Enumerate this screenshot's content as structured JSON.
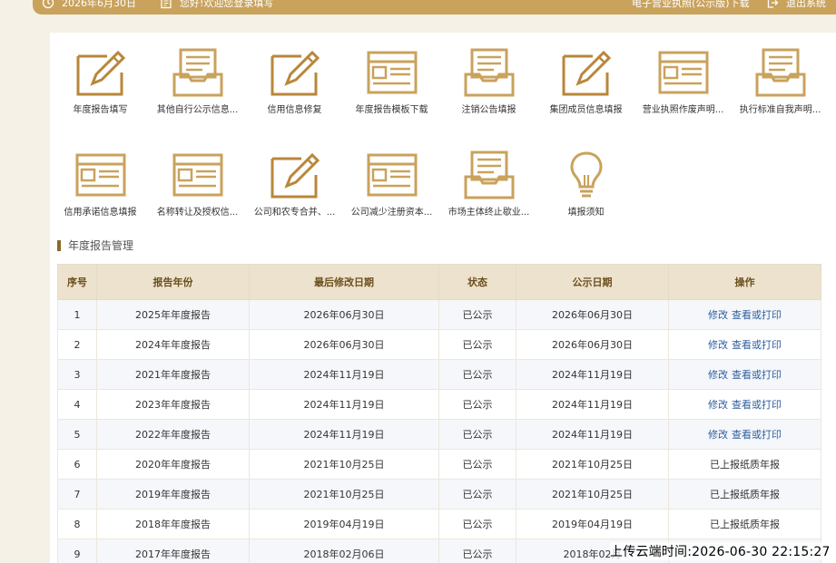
{
  "topbar": {
    "date": "2026年6月30日",
    "message": "您好!欢迎您登录填写",
    "license_download": "电子营业执照(公示版)下载",
    "logout": "退出系统"
  },
  "colors": {
    "accent": "#c9a25c",
    "header_bg": "#ede2cd",
    "link": "#2f5e9e"
  },
  "tiles": [
    {
      "label": "年度报告填写",
      "icon": "pencil-icon"
    },
    {
      "label": "其他自行公示信息...",
      "icon": "inbox-icon"
    },
    {
      "label": "信用信息修复",
      "icon": "pencil-icon"
    },
    {
      "label": "年度报告模板下载",
      "icon": "form-icon"
    },
    {
      "label": "注销公告填报",
      "icon": "inbox-icon"
    },
    {
      "label": "集团成员信息填报",
      "icon": "pencil-icon"
    },
    {
      "label": "营业执照作废声明...",
      "icon": "form-icon"
    },
    {
      "label": "执行标准自我声明...",
      "icon": "inbox-icon"
    },
    {
      "label": "信用承诺信息填报",
      "icon": "form-icon"
    },
    {
      "label": "名称转让及授权信...",
      "icon": "form-icon"
    },
    {
      "label": "公司和农专合并、...",
      "icon": "pencil-icon"
    },
    {
      "label": "公司减少注册资本...",
      "icon": "form-icon"
    },
    {
      "label": "市场主体终止歇业...",
      "icon": "inbox-icon"
    },
    {
      "label": "填报须知",
      "icon": "bulb-icon"
    }
  ],
  "section": {
    "title": "年度报告管理"
  },
  "table": {
    "headers": [
      "序号",
      "报告年份",
      "最后修改日期",
      "状态",
      "公示日期",
      "操作"
    ],
    "rows": [
      {
        "no": "1",
        "year": "2025年年度报告",
        "modified": "2026年06月30日",
        "status": "已公示",
        "published": "2026年06月30日",
        "edit": "修改",
        "view": "查看或打印",
        "note": ""
      },
      {
        "no": "2",
        "year": "2024年年度报告",
        "modified": "2026年06月30日",
        "status": "已公示",
        "published": "2026年06月30日",
        "edit": "修改",
        "view": "查看或打印",
        "note": ""
      },
      {
        "no": "3",
        "year": "2021年年度报告",
        "modified": "2024年11月19日",
        "status": "已公示",
        "published": "2024年11月19日",
        "edit": "修改",
        "view": "查看或打印",
        "note": ""
      },
      {
        "no": "4",
        "year": "2023年年度报告",
        "modified": "2024年11月19日",
        "status": "已公示",
        "published": "2024年11月19日",
        "edit": "修改",
        "view": "查看或打印",
        "note": ""
      },
      {
        "no": "5",
        "year": "2022年年度报告",
        "modified": "2024年11月19日",
        "status": "已公示",
        "published": "2024年11月19日",
        "edit": "修改",
        "view": "查看或打印",
        "note": ""
      },
      {
        "no": "6",
        "year": "2020年年度报告",
        "modified": "2021年10月25日",
        "status": "已公示",
        "published": "2021年10月25日",
        "edit": "",
        "view": "",
        "note": "已上报纸质年报"
      },
      {
        "no": "7",
        "year": "2019年年度报告",
        "modified": "2021年10月25日",
        "status": "已公示",
        "published": "2021年10月25日",
        "edit": "",
        "view": "",
        "note": "已上报纸质年报"
      },
      {
        "no": "8",
        "year": "2018年年度报告",
        "modified": "2019年04月19日",
        "status": "已公示",
        "published": "2019年04月19日",
        "edit": "",
        "view": "",
        "note": "已上报纸质年报"
      },
      {
        "no": "9",
        "year": "2017年年度报告",
        "modified": "2018年02月06日",
        "status": "已公示",
        "published": "2018年02月",
        "edit": "",
        "view": "",
        "note": ""
      }
    ]
  },
  "watermark": "上传云端时间:2026-06-30 22:15:27"
}
